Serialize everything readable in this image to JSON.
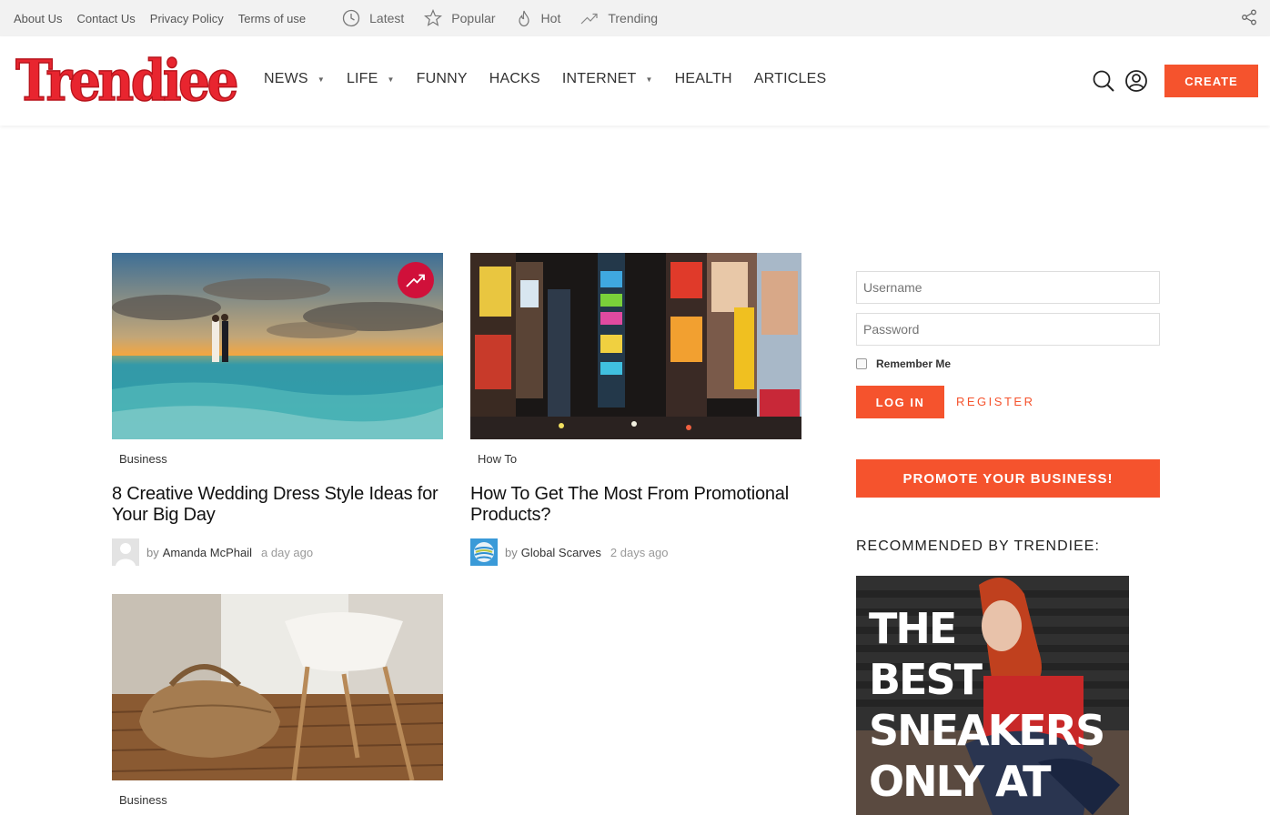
{
  "topbar": {
    "links": [
      "About Us",
      "Contact Us",
      "Privacy Policy",
      "Terms of use"
    ],
    "nav": [
      {
        "label": "Latest",
        "icon": "clock-icon"
      },
      {
        "label": "Popular",
        "icon": "star-icon"
      },
      {
        "label": "Hot",
        "icon": "flame-icon"
      },
      {
        "label": "Trending",
        "icon": "trending-icon"
      }
    ]
  },
  "header": {
    "logo": "Trendiee",
    "nav": [
      {
        "label": "NEWS",
        "dropdown": true
      },
      {
        "label": "LIFE",
        "dropdown": true
      },
      {
        "label": "FUNNY",
        "dropdown": false
      },
      {
        "label": "HACKS",
        "dropdown": false
      },
      {
        "label": "INTERNET",
        "dropdown": true
      },
      {
        "label": "HEALTH",
        "dropdown": false
      },
      {
        "label": "ARTICLES",
        "dropdown": false
      }
    ],
    "create_label": "CREATE"
  },
  "posts": [
    {
      "category": "Business",
      "title": "8 Creative Wedding Dress Style Ideas for Your Big Day",
      "by": "by",
      "author": "Amanda McPhail",
      "time": "a day ago",
      "trending": true
    },
    {
      "category": "How To",
      "title": "How To Get The Most From Promotional Products?",
      "by": "by",
      "author": "Global Scarves",
      "time": "2 days ago",
      "trending": false
    },
    {
      "category": "Business",
      "title": "",
      "trending": false
    }
  ],
  "sidebar": {
    "username_placeholder": "Username",
    "password_placeholder": "Password",
    "remember_label": "Remember Me",
    "login_label": "LOG IN",
    "register_label": "REGISTER",
    "promote_label": "PROMOTE YOUR BUSINESS!",
    "recommended_title": "RECOMMENDED BY TRENDIEE:",
    "ad_lines": [
      "THE",
      "BEST",
      "SNEAKERS",
      "ONLY AT"
    ]
  },
  "colors": {
    "accent": "#f5532d",
    "logo_red": "#e8252f",
    "trending_badge": "#d0103a"
  }
}
